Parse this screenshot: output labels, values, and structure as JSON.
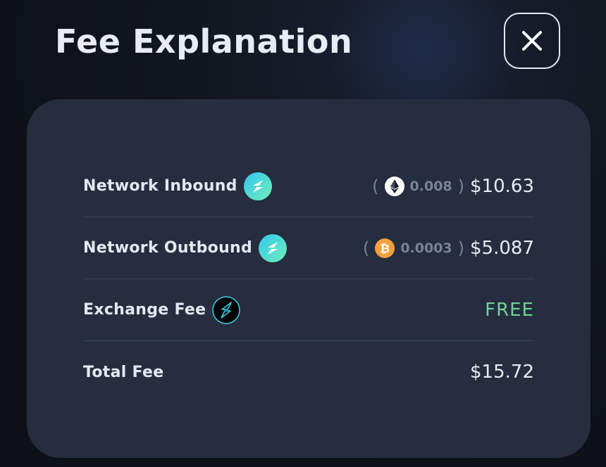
{
  "header": {
    "title": "Fee Explanation",
    "close_icon": "close-icon"
  },
  "fees": [
    {
      "label": "Network Inbound",
      "icon": "thorchain-icon",
      "paren_open": "(",
      "crypto_icon": "ethereum-icon",
      "crypto_amount": "0.008",
      "paren_close": ")",
      "usd": "$10.63"
    },
    {
      "label": "Network Outbound",
      "icon": "thorchain-icon",
      "paren_open": "(",
      "crypto_icon": "bitcoin-icon",
      "crypto_amount": "0.0003",
      "paren_close": ")",
      "usd": "$5.087"
    },
    {
      "label": "Exchange Fee",
      "icon": "exchange-bolt-icon",
      "value": "FREE"
    },
    {
      "label": "Total Fee",
      "value": "$15.72"
    }
  ],
  "colors": {
    "card_bg": "#252d3e",
    "free_text": "#6fd39a",
    "bitcoin": "#f2a03f",
    "thorchain_gradient_start": "#33c5f0",
    "thorchain_gradient_end": "#6ff0b8"
  }
}
